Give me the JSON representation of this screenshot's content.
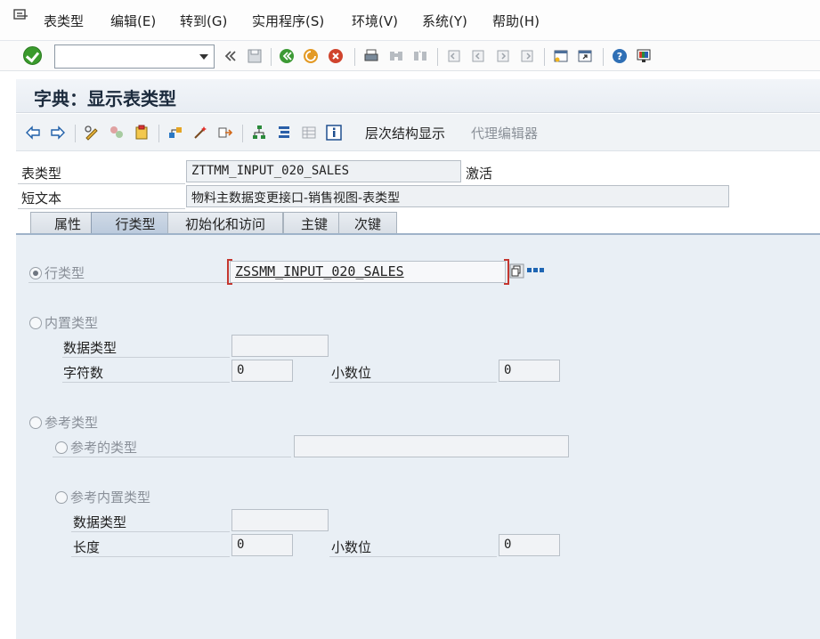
{
  "menu": {
    "items": [
      "表类型",
      "编辑(E)",
      "转到(G)",
      "实用程序(S)",
      "环境(V)",
      "系统(Y)",
      "帮助(H)"
    ]
  },
  "toolbar": {
    "command_value": "",
    "icons": [
      "enter-icon",
      "command-dropdown-icon",
      "double-chevron-icon",
      "save-icon",
      "back-icon",
      "exit-icon",
      "cancel-icon",
      "print-icon",
      "find-icon",
      "find-next-icon",
      "first-page-icon",
      "prev-page-icon",
      "next-page-icon",
      "last-page-icon",
      "create-session-icon",
      "shortcut-icon",
      "help-icon",
      "customize-layout-icon"
    ]
  },
  "title": "字典：显示表类型",
  "app_toolbar": {
    "hierarchy_label": "层次结构显示",
    "proxy_editor_label": "代理编辑器"
  },
  "header": {
    "table_type_label": "表类型",
    "table_type_value": "ZTTMM_INPUT_020_SALES",
    "status": "激活",
    "short_text_label": "短文本",
    "short_text_value": "物料主数据变更接口-销售视图-表类型"
  },
  "tabs": [
    {
      "label": "属性",
      "active": false
    },
    {
      "label": "行类型",
      "active": true
    },
    {
      "label": "初始化和访问",
      "active": false
    },
    {
      "label": "主键",
      "active": false
    },
    {
      "label": "次键",
      "active": false
    }
  ],
  "row_type": {
    "radio_label": "行类型",
    "selected": true,
    "value": "ZSSMM_INPUT_020_SALES"
  },
  "builtin_type": {
    "radio_label": "内置类型",
    "data_type_label": "数据类型",
    "data_type_value": "",
    "chars_label": "字符数",
    "chars_value": "0",
    "decimals_label": "小数位",
    "decimals_value": "0"
  },
  "reference_type": {
    "radio_label": "参考类型",
    "ref_type_label": "参考的类型",
    "ref_type_value": "",
    "ref_builtin_label": "参考内置类型",
    "data_type_label": "数据类型",
    "data_type_value": "",
    "length_label": "长度",
    "length_value": "0",
    "decimals_label": "小数位",
    "decimals_value": "0"
  }
}
